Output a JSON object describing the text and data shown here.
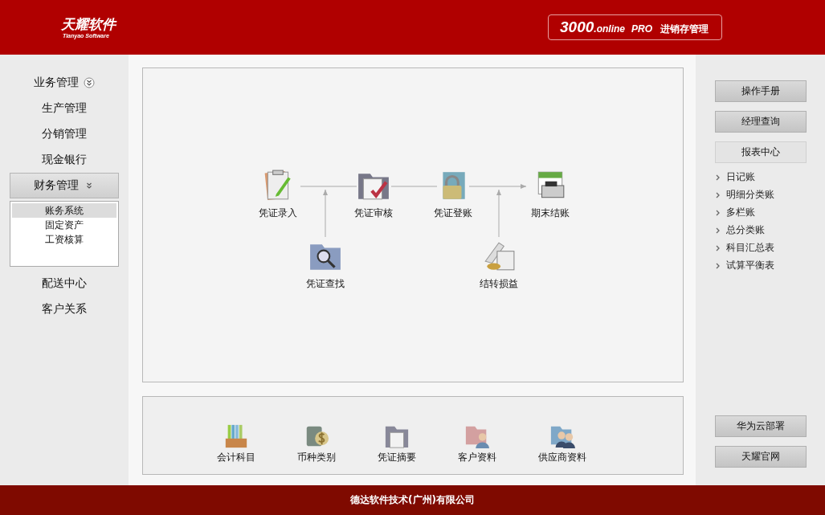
{
  "header": {
    "logo": "天耀软件",
    "logo_subtitle": "Tianyao Software",
    "product": {
      "version": "3000",
      "edition": ".online",
      "tier": "PRO",
      "name": "进销存管理"
    }
  },
  "sidebar": {
    "items": [
      {
        "label": "业务管理",
        "kind": "group",
        "expanded": false
      },
      {
        "label": "生产管理",
        "kind": "plain"
      },
      {
        "label": "分销管理",
        "kind": "plain"
      },
      {
        "label": "现金银行",
        "kind": "plain"
      },
      {
        "label": "财务管理",
        "kind": "group",
        "expanded": true,
        "children": [
          {
            "label": "账务系统",
            "selected": true
          },
          {
            "label": "固定资产",
            "selected": false
          },
          {
            "label": "工资核算",
            "selected": false
          }
        ]
      },
      {
        "label": "配送中心",
        "kind": "plain"
      },
      {
        "label": "客户关系",
        "kind": "plain"
      }
    ]
  },
  "flow": {
    "nodes": [
      {
        "label": "凭证录入",
        "kind": "entry"
      },
      {
        "label": "凭证审核",
        "kind": "audit"
      },
      {
        "label": "凭证登账",
        "kind": "post"
      },
      {
        "label": "期末结账",
        "kind": "close"
      },
      {
        "label": "凭证查找",
        "kind": "search"
      },
      {
        "label": "结转损益",
        "kind": "transfer"
      }
    ]
  },
  "shortcuts": [
    {
      "label": "会计科目",
      "kind": "books"
    },
    {
      "label": "币种类别",
      "kind": "currency"
    },
    {
      "label": "凭证摘要",
      "kind": "folder"
    },
    {
      "label": "客户资料",
      "kind": "customer"
    },
    {
      "label": "供应商资料",
      "kind": "supplier"
    }
  ],
  "right_panel": {
    "buttons": [
      {
        "label": "操作手册",
        "selected": false
      },
      {
        "label": "经理查询",
        "selected": false
      },
      {
        "label": "报表中心",
        "selected": true
      }
    ],
    "reports": [
      "日记账",
      "明细分类账",
      "多栏账",
      "总分类账",
      "科目汇总表",
      "试算平衡表"
    ],
    "bottom_buttons": [
      "华为云部署",
      "天耀官网"
    ]
  },
  "footer": "德达软件技术(广州)有限公司"
}
